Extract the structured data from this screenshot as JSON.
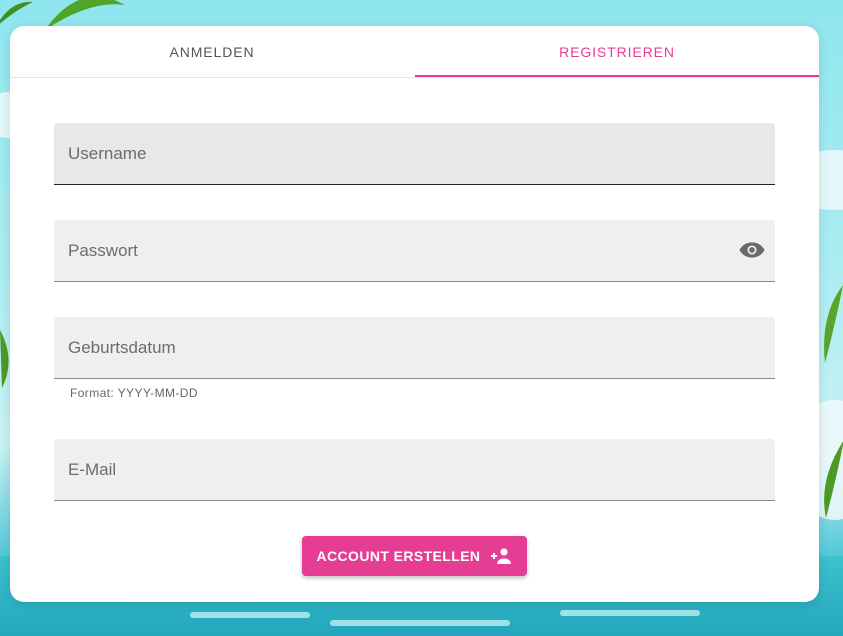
{
  "tabs": [
    {
      "label": "ANMELDEN",
      "active": false
    },
    {
      "label": "REGISTRIEREN",
      "active": true
    }
  ],
  "form": {
    "username": {
      "label": "Username",
      "value": ""
    },
    "password": {
      "label": "Passwort",
      "value": "",
      "icon": "eye-icon"
    },
    "birthdate": {
      "label": "Geburtsdatum",
      "value": "",
      "hint": "Format: YYYY-MM-DD"
    },
    "email": {
      "label": "E-Mail",
      "value": ""
    }
  },
  "submit": {
    "label": "ACCOUNT ERSTELLEN",
    "icon": "person-add-icon"
  },
  "colors": {
    "accent": "#e53d93",
    "field_bg": "#efefef",
    "card_bg": "#ffffff"
  }
}
